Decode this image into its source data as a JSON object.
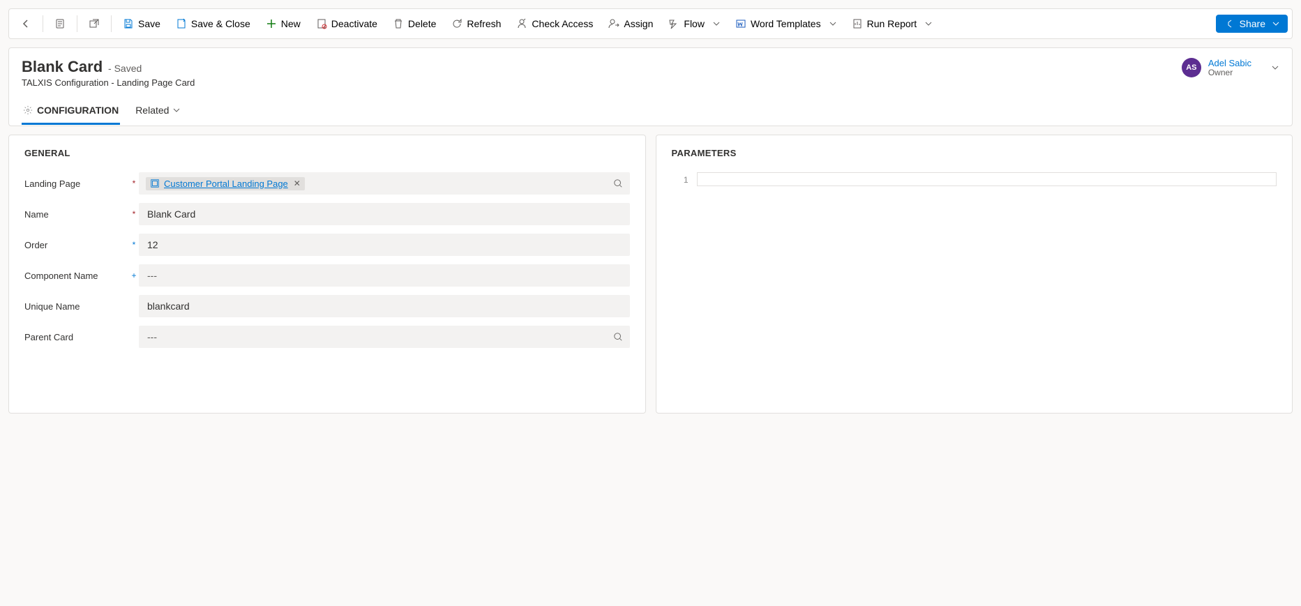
{
  "commands": {
    "save": "Save",
    "saveClose": "Save & Close",
    "new": "New",
    "deactivate": "Deactivate",
    "delete": "Delete",
    "refresh": "Refresh",
    "checkAccess": "Check Access",
    "assign": "Assign",
    "flow": "Flow",
    "wordTemplates": "Word Templates",
    "runReport": "Run Report",
    "share": "Share"
  },
  "record": {
    "title": "Blank Card",
    "savedLabel": "- Saved",
    "subtitle": "TALXIS Configuration - Landing Page Card"
  },
  "owner": {
    "initials": "AS",
    "name": "Adel Sabic",
    "role": "Owner"
  },
  "tabs": {
    "configuration": "CONFIGURATION",
    "related": "Related"
  },
  "sections": {
    "general": "GENERAL",
    "parameters": "PARAMETERS"
  },
  "fields": {
    "landingPage": {
      "label": "Landing Page",
      "value": "Customer Portal Landing Page"
    },
    "name": {
      "label": "Name",
      "value": "Blank Card"
    },
    "order": {
      "label": "Order",
      "value": "12"
    },
    "componentName": {
      "label": "Component Name",
      "placeholder": "---",
      "value": ""
    },
    "uniqueName": {
      "label": "Unique Name",
      "value": "blankcard"
    },
    "parentCard": {
      "label": "Parent Card",
      "placeholder": "---",
      "value": ""
    }
  },
  "parameters": {
    "lineNumber": "1",
    "lineValue": ""
  }
}
